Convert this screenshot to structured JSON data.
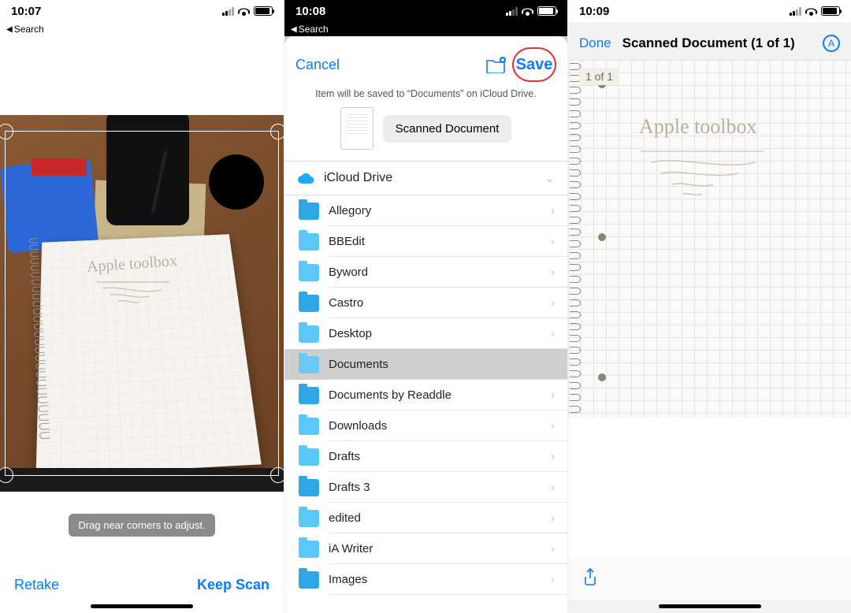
{
  "screen1": {
    "status_time": "10:07",
    "back_label": "Search",
    "hint": "Drag near corners to adjust.",
    "retake": "Retake",
    "keep": "Keep Scan",
    "handwriting": "Apple toolbox"
  },
  "screen2": {
    "status_time": "10:08",
    "back_label": "Search",
    "cancel": "Cancel",
    "save": "Save",
    "subtext": "Item will be saved to “Documents” on iCloud Drive.",
    "doc_name": "Scanned Document",
    "drive_label": "iCloud Drive",
    "folders": [
      {
        "name": "Allegory"
      },
      {
        "name": "BBEdit"
      },
      {
        "name": "Byword"
      },
      {
        "name": "Castro"
      },
      {
        "name": "Desktop"
      },
      {
        "name": "Documents",
        "selected": true
      },
      {
        "name": "Documents by Readdle"
      },
      {
        "name": "Downloads"
      },
      {
        "name": "Drafts"
      },
      {
        "name": "Drafts 3"
      },
      {
        "name": "edited"
      },
      {
        "name": "iA Writer"
      },
      {
        "name": "Images"
      }
    ]
  },
  "screen3": {
    "status_time": "10:09",
    "done": "Done",
    "title": "Scanned Document (1 of 1)",
    "badge": "1 of 1",
    "handwriting": "Apple toolbox"
  }
}
